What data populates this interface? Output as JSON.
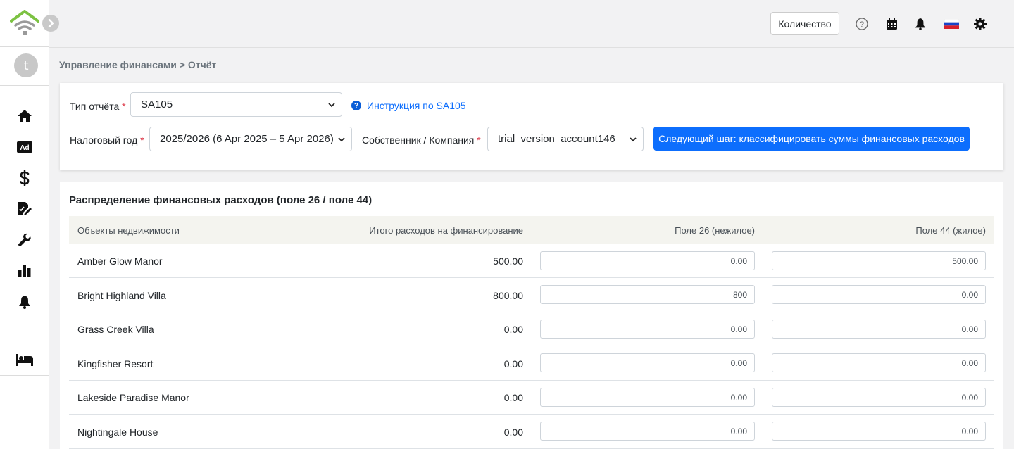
{
  "app": {
    "avatar_letter": "t",
    "brand_color": "#7cc242",
    "accent_color": "#0d6efd"
  },
  "sidebar": {
    "items": [
      {
        "icon": "home-icon"
      },
      {
        "icon": "ad-icon",
        "label": "Ad"
      },
      {
        "icon": "dollar-icon"
      },
      {
        "icon": "document-edit-icon"
      },
      {
        "icon": "wrench-icon"
      },
      {
        "icon": "bar-chart-icon"
      },
      {
        "icon": "bell-icon"
      },
      {
        "icon": "bed-icon"
      }
    ]
  },
  "topbar": {
    "quantity_button": "Количество",
    "icons": [
      "help-icon",
      "calendar-icon",
      "notification-bell-icon",
      "russian-flag-icon",
      "settings-gear-icon"
    ]
  },
  "breadcrumb": "Управление финансами > Отчёт",
  "form": {
    "report_type_label": "Тип отчёта",
    "report_type_value": "SA105",
    "help_link": "Инструкция по SA105",
    "tax_year_label": "Налоговый год",
    "tax_year_value": "2025/2026 (6 Apr 2025 – 5 Apr 2026)",
    "owner_label": "Собственник / Компания",
    "owner_value": "trial_version_account146",
    "required_mark": "*",
    "next_button": "Следующий шаг: классифицировать суммы финансовых расходов"
  },
  "table": {
    "title": "Распределение финансовых расходов (поле 26 / поле 44)",
    "columns": [
      "Объекты недвижимости",
      "Итого расходов на финансирование",
      "Поле 26 (нежилое)",
      "Поле 44 (жилое)"
    ],
    "rows": [
      {
        "property": "Amber Glow Manor",
        "total": "500.00",
        "box26": "0.00",
        "box44": "500.00"
      },
      {
        "property": "Bright Highland Villa",
        "total": "800.00",
        "box26": "800",
        "box44": "0.00"
      },
      {
        "property": "Grass Creek Villa",
        "total": "0.00",
        "box26": "0.00",
        "box44": "0.00"
      },
      {
        "property": "Kingfisher Resort",
        "total": "0.00",
        "box26": "0.00",
        "box44": "0.00"
      },
      {
        "property": "Lakeside Paradise Manor",
        "total": "0.00",
        "box26": "0.00",
        "box44": "0.00"
      },
      {
        "property": "Nightingale House",
        "total": "0.00",
        "box26": "0.00",
        "box44": "0.00"
      }
    ]
  }
}
